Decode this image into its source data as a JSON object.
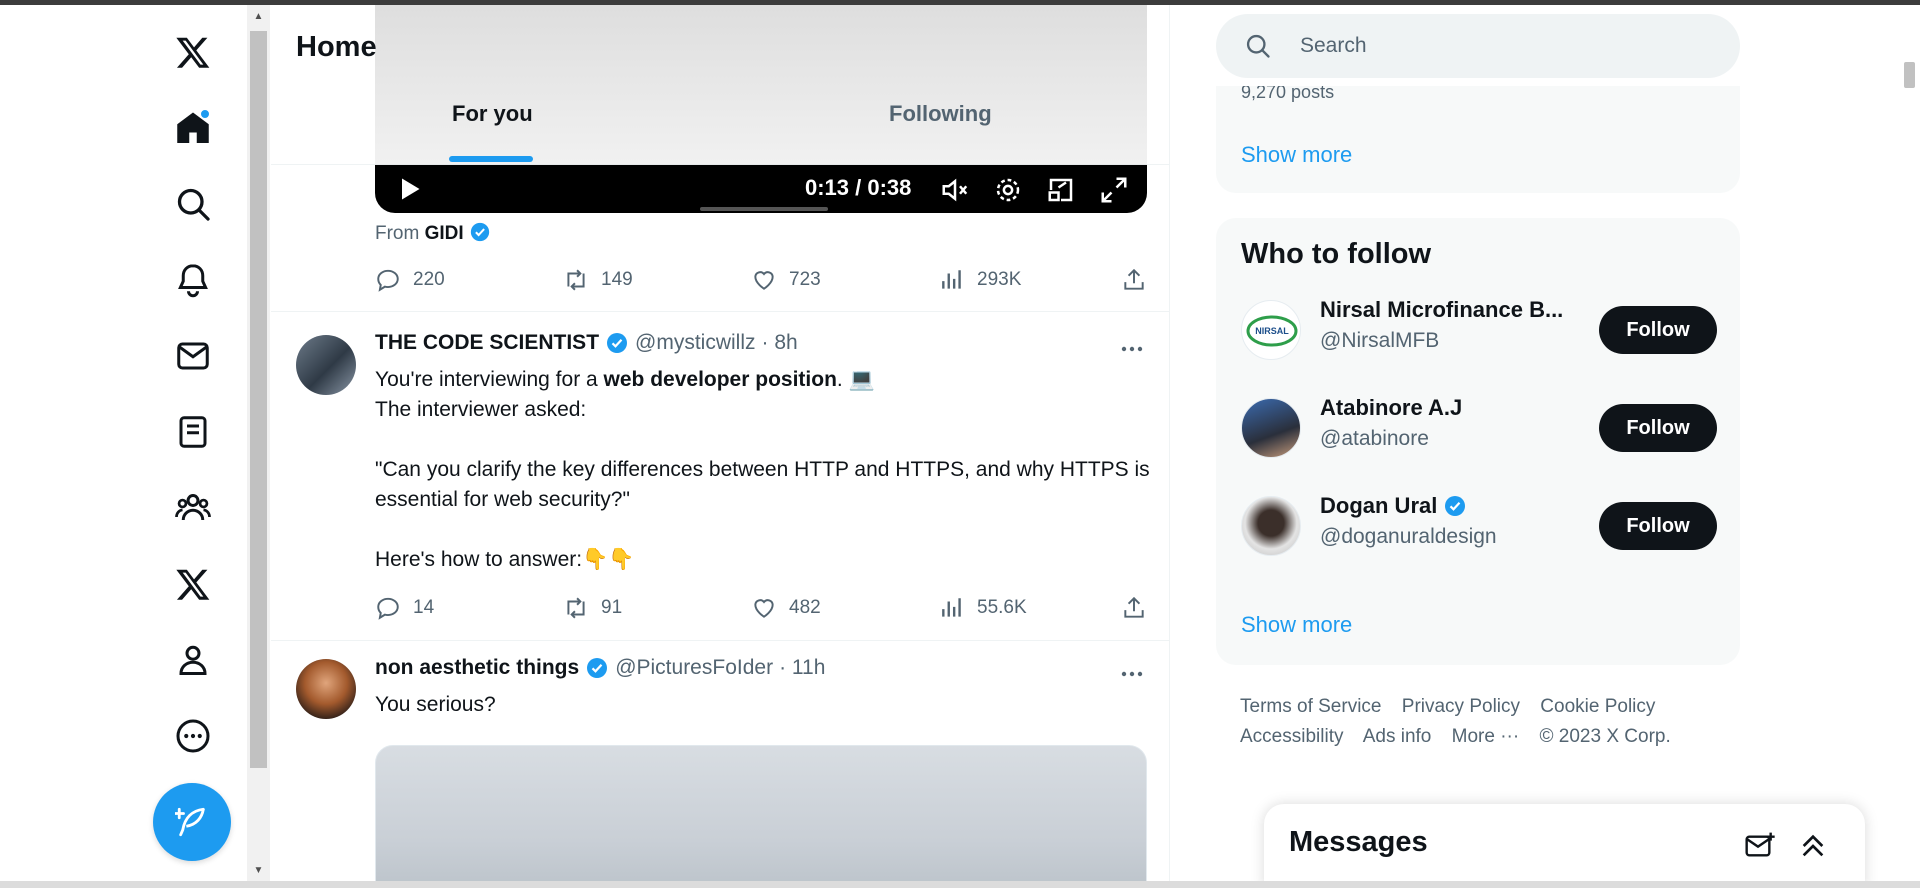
{
  "nav": {
    "items": [
      {
        "name": "x-logo-icon",
        "label": "X"
      },
      {
        "name": "home-icon",
        "label": "Home"
      },
      {
        "name": "explore-icon",
        "label": "Explore"
      },
      {
        "name": "notifications-icon",
        "label": "Notifications"
      },
      {
        "name": "messages-icon",
        "label": "Messages"
      },
      {
        "name": "lists-icon",
        "label": "Lists"
      },
      {
        "name": "communities-icon",
        "label": "Communities"
      },
      {
        "name": "premium-icon",
        "label": "Premium"
      },
      {
        "name": "profile-icon",
        "label": "Profile"
      },
      {
        "name": "more-icon",
        "label": "More"
      }
    ],
    "post_button_icon": "feather-plus-icon"
  },
  "header": {
    "title": "Home",
    "tabs": [
      {
        "label": "For you",
        "active": true
      },
      {
        "label": "Following",
        "active": false
      }
    ]
  },
  "video": {
    "time": "0:13 / 0:38",
    "from_prefix": "From",
    "from_name": "GIDI"
  },
  "tweets": [
    {
      "actions": {
        "replies": "220",
        "reposts": "149",
        "likes": "723",
        "views": "293K"
      }
    },
    {
      "name": "THE CODE SCIENTIST",
      "handle": "@mysticwillz",
      "time": "· 8h",
      "text_parts": {
        "line1_prefix": "You're interviewing for a ",
        "line1_bold": "web developer position",
        "line1_suffix": ". 💻",
        "line2": "The interviewer asked:",
        "line3": "\"Can you clarify the key differences between HTTP and HTTPS, and why HTTPS is essential for web security?\"",
        "line4": "Here's how to answer:👇👇"
      },
      "actions": {
        "replies": "14",
        "reposts": "91",
        "likes": "482",
        "views": "55.6K"
      }
    },
    {
      "name": "non aesthetic things",
      "handle": "@PicturesFoIder",
      "time": "· 11h",
      "text": "You serious?"
    }
  ],
  "search": {
    "placeholder": "Search"
  },
  "trending": {
    "posts": "9,270 posts",
    "show_more": "Show more"
  },
  "who_to_follow": {
    "title": "Who to follow",
    "accounts": [
      {
        "name": "Nirsal Microfinance B...",
        "handle": "@NirsalMFB",
        "button": "Follow",
        "verified": false
      },
      {
        "name": "Atabinore A.J",
        "handle": "@atabinore",
        "button": "Follow",
        "verified": false
      },
      {
        "name": "Dogan Ural",
        "handle": "@doganuraldesign",
        "button": "Follow",
        "verified": true
      }
    ],
    "show_more": "Show more"
  },
  "footer": {
    "links": [
      "Terms of Service",
      "Privacy Policy",
      "Cookie Policy",
      "Accessibility",
      "Ads info",
      "More ···"
    ],
    "copyright": "© 2023 X Corp."
  },
  "messages": {
    "title": "Messages"
  },
  "colors": {
    "accent": "#1d9bf0",
    "text": "#0f1419",
    "muted": "#536471"
  }
}
